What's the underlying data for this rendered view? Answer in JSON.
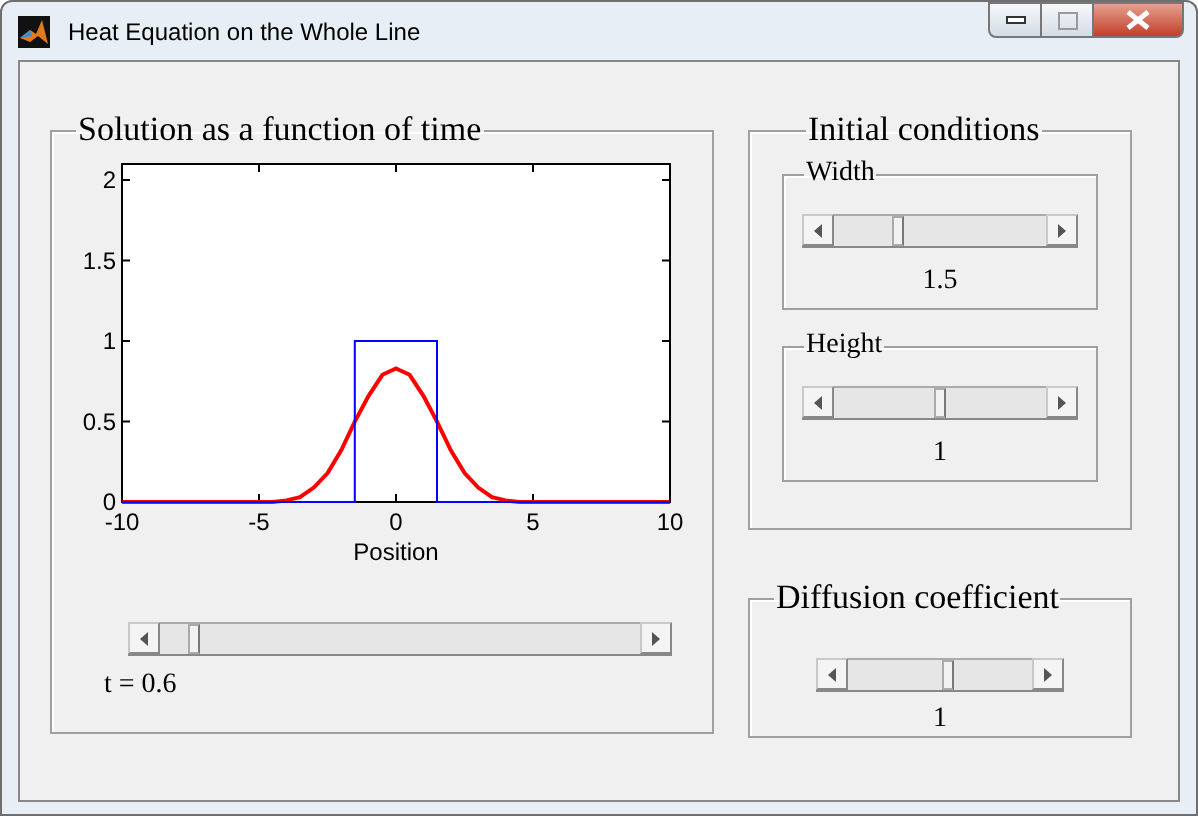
{
  "window": {
    "title": "Heat Equation on the Whole Line"
  },
  "solution_panel": {
    "title": "Solution as a function of time",
    "chart_data": {
      "type": "line",
      "xlabel": "Position",
      "x": [
        -10,
        -9.5,
        -9,
        -8.5,
        -8,
        -7.5,
        -7,
        -6.5,
        -6,
        -5.5,
        -5,
        -4.5,
        -4,
        -3.5,
        -3,
        -2.5,
        -2,
        -1.5,
        -1,
        -0.5,
        0,
        0.5,
        1,
        1.5,
        2,
        2.5,
        3,
        3.5,
        4,
        4.5,
        5,
        5.5,
        6,
        6.5,
        7,
        7.5,
        8,
        8.5,
        9,
        9.5,
        10
      ],
      "xlim": [
        -10,
        10
      ],
      "ylim": [
        0,
        2.1
      ],
      "xticks": [
        -10,
        -5,
        0,
        5,
        10
      ],
      "yticks": [
        0,
        0.5,
        1,
        1.5,
        2
      ],
      "series": [
        {
          "color": "#ff0000",
          "values": [
            0,
            0,
            0,
            0,
            0,
            0,
            0,
            0,
            0,
            0,
            0,
            0,
            0.01,
            0.03,
            0.09,
            0.18,
            0.32,
            0.5,
            0.66,
            0.79,
            0.83,
            0.79,
            0.66,
            0.5,
            0.32,
            0.18,
            0.09,
            0.03,
            0.01,
            0,
            0,
            0,
            0,
            0,
            0,
            0,
            0,
            0,
            0,
            0,
            0
          ]
        },
        {
          "color": "#0000ff",
          "x": [
            -10,
            -1.5,
            -1.5,
            1.5,
            1.5,
            10
          ],
          "values": [
            0,
            0,
            1,
            1,
            0,
            0
          ]
        }
      ]
    },
    "time_slider": {
      "level": 0.06
    },
    "time_label": "t = 0.6"
  },
  "initial_conditions": {
    "title": "Initial conditions",
    "groups": [
      {
        "title": "Width",
        "level": 0.29,
        "value": "1.5"
      },
      {
        "title": "Height",
        "level": 0.5,
        "value": "1"
      }
    ]
  },
  "diffusion": {
    "title": "Diffusion coefficient",
    "level": 0.55,
    "value": "1"
  }
}
